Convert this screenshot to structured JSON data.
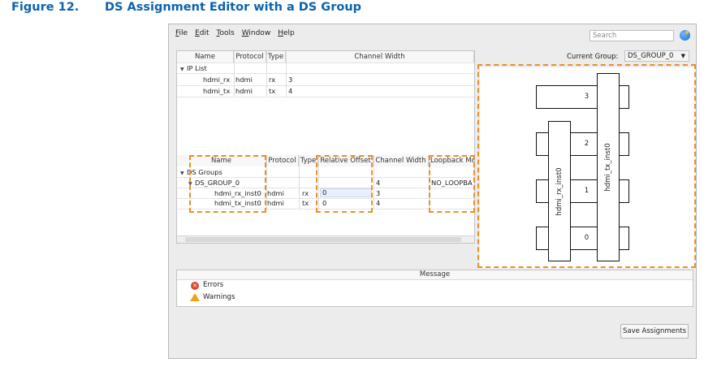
{
  "caption": {
    "number": "Figure 12.",
    "title": "DS Assignment Editor with a DS Group"
  },
  "menu": [
    "File",
    "Edit",
    "Tools",
    "Window",
    "Help"
  ],
  "search": {
    "placeholder": "Search"
  },
  "ip_list": {
    "headers": [
      "Name",
      "Protocol",
      "Type",
      "Channel Width"
    ],
    "group_label": "IP List",
    "rows": [
      {
        "name": "hdmi_rx",
        "protocol": "hdmi",
        "type": "rx",
        "width": "3"
      },
      {
        "name": "hdmi_tx",
        "protocol": "hdmi",
        "type": "tx",
        "width": "4"
      }
    ]
  },
  "current_group": {
    "label": "Current Group:",
    "value": "DS_GROUP_0"
  },
  "ds_table": {
    "headers": [
      "Name",
      "Protocol",
      "Type",
      "Relative Offset",
      "Channel Width",
      "Loopback Mo"
    ],
    "root_label": "DS Groups",
    "group": {
      "name": "DS_GROUP_0",
      "width": "4",
      "loopback": "NO_LOOPBA"
    },
    "rows": [
      {
        "name": "hdmi_rx_inst0",
        "protocol": "hdmi",
        "type": "rx",
        "offset": "0",
        "width": "3"
      },
      {
        "name": "hdmi_tx_inst0",
        "protocol": "hdmi",
        "type": "tx",
        "offset": "0",
        "width": "4"
      }
    ]
  },
  "diagram": {
    "slots": [
      "3",
      "2",
      "1",
      "0"
    ],
    "lanes": [
      "hdmi_rx_inst0",
      "hdmi_tx_inst0"
    ]
  },
  "messages": {
    "header": "Message",
    "errors": "Errors",
    "warnings": "Warnings"
  },
  "save_button": "Save Assignments",
  "colors": {
    "caption": "#0a63b0",
    "highlight": "#e8902c"
  }
}
